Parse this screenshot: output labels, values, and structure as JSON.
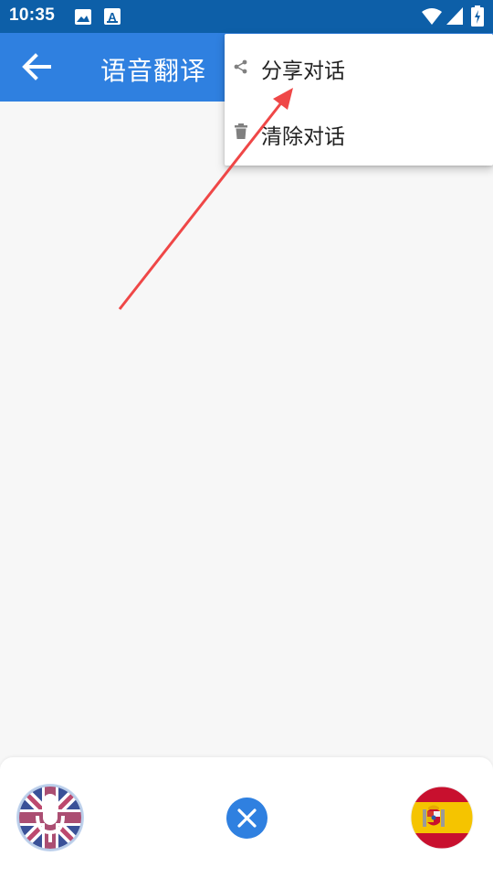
{
  "status_bar": {
    "time": "10:35",
    "icons": [
      "image-icon",
      "a-box-icon",
      "wifi-icon",
      "signal-icon",
      "battery-icon"
    ]
  },
  "app_bar": {
    "title": "语音翻译",
    "back_icon": "arrow-left-icon",
    "background": "#2f80e0"
  },
  "menu": {
    "items": [
      {
        "label": "分享对话",
        "icon": "share-icon"
      },
      {
        "label": "清除对话",
        "icon": "trash-icon"
      }
    ]
  },
  "bottom_bar": {
    "left_flag": "uk-flag-mic-icon",
    "center_button": "close-icon",
    "right_flag": "spain-flag-icon"
  },
  "colors": {
    "status_bar": "#0d5fa8",
    "accent": "#2f80e0",
    "annotation_arrow": "#ef4747"
  }
}
